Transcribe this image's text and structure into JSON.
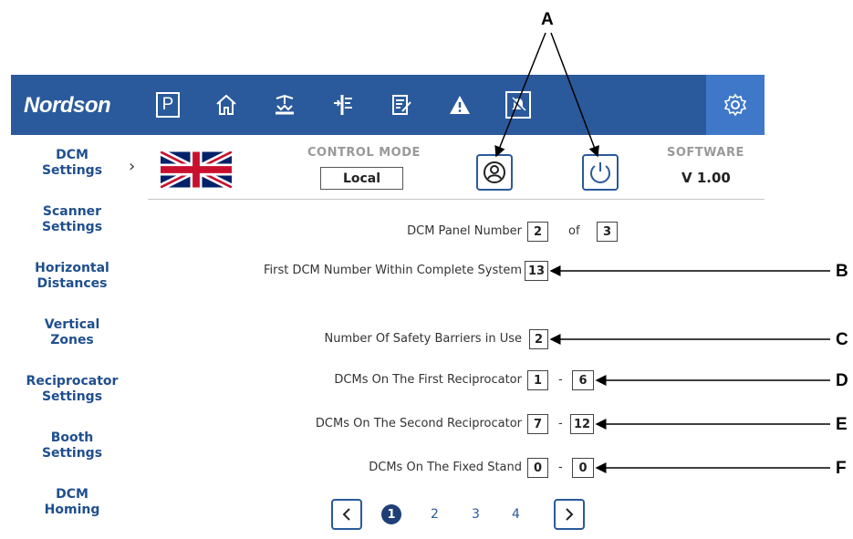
{
  "callouts": {
    "a": "A",
    "b": "B",
    "c": "C",
    "d": "D",
    "e": "E",
    "f": "F"
  },
  "brand": {
    "logo": "Nordson"
  },
  "nav": {
    "icons": [
      "parking-icon",
      "home-icon",
      "spray-gun-icon",
      "reciprocator-icon",
      "checklist-icon",
      "warning-icon",
      "alarm-muted-icon",
      "gear-icon"
    ],
    "parking_label": "P"
  },
  "sidebar": {
    "items": [
      {
        "line1": "DCM",
        "line2": "Settings"
      },
      {
        "line1": "Scanner",
        "line2": "Settings"
      },
      {
        "line1": "Horizontal",
        "line2": "Distances"
      },
      {
        "line1": "Vertical",
        "line2": "Zones"
      },
      {
        "line1": "Reciprocator",
        "line2": "Settings"
      },
      {
        "line1": "Booth",
        "line2": "Settings"
      },
      {
        "line1": "DCM",
        "line2": "Homing"
      }
    ],
    "chevron": "›"
  },
  "header": {
    "control_mode_label": "CONTROL MODE",
    "control_mode_value": "Local",
    "software_label": "SOFTWARE",
    "software_version": "V 1.00",
    "flag": "uk-flag-icon"
  },
  "form": {
    "panel_number_label": "DCM Panel Number",
    "panel_number": "2",
    "of_label": "of",
    "panel_total": "3",
    "first_dcm_label": "First DCM Number Within Complete System",
    "first_dcm": "13",
    "barriers_label": "Number Of Safety Barriers in Use",
    "barriers": "2",
    "first_recip_label": "DCMs On The First Reciprocator",
    "first_recip_from": "1",
    "first_recip_to": "6",
    "second_recip_label": "DCMs On The Second Reciprocator",
    "second_recip_from": "7",
    "second_recip_to": "12",
    "fixed_stand_label": "DCMs On The Fixed Stand",
    "fixed_from": "0",
    "fixed_to": "0",
    "range_sep": "-"
  },
  "pagination": {
    "pages": [
      "1",
      "2",
      "3",
      "4"
    ],
    "current": 1
  },
  "colors": {
    "topbar": "#2a5a9b",
    "active_tab": "#3f78c8",
    "sidebar_text": "#1f4f8f"
  }
}
